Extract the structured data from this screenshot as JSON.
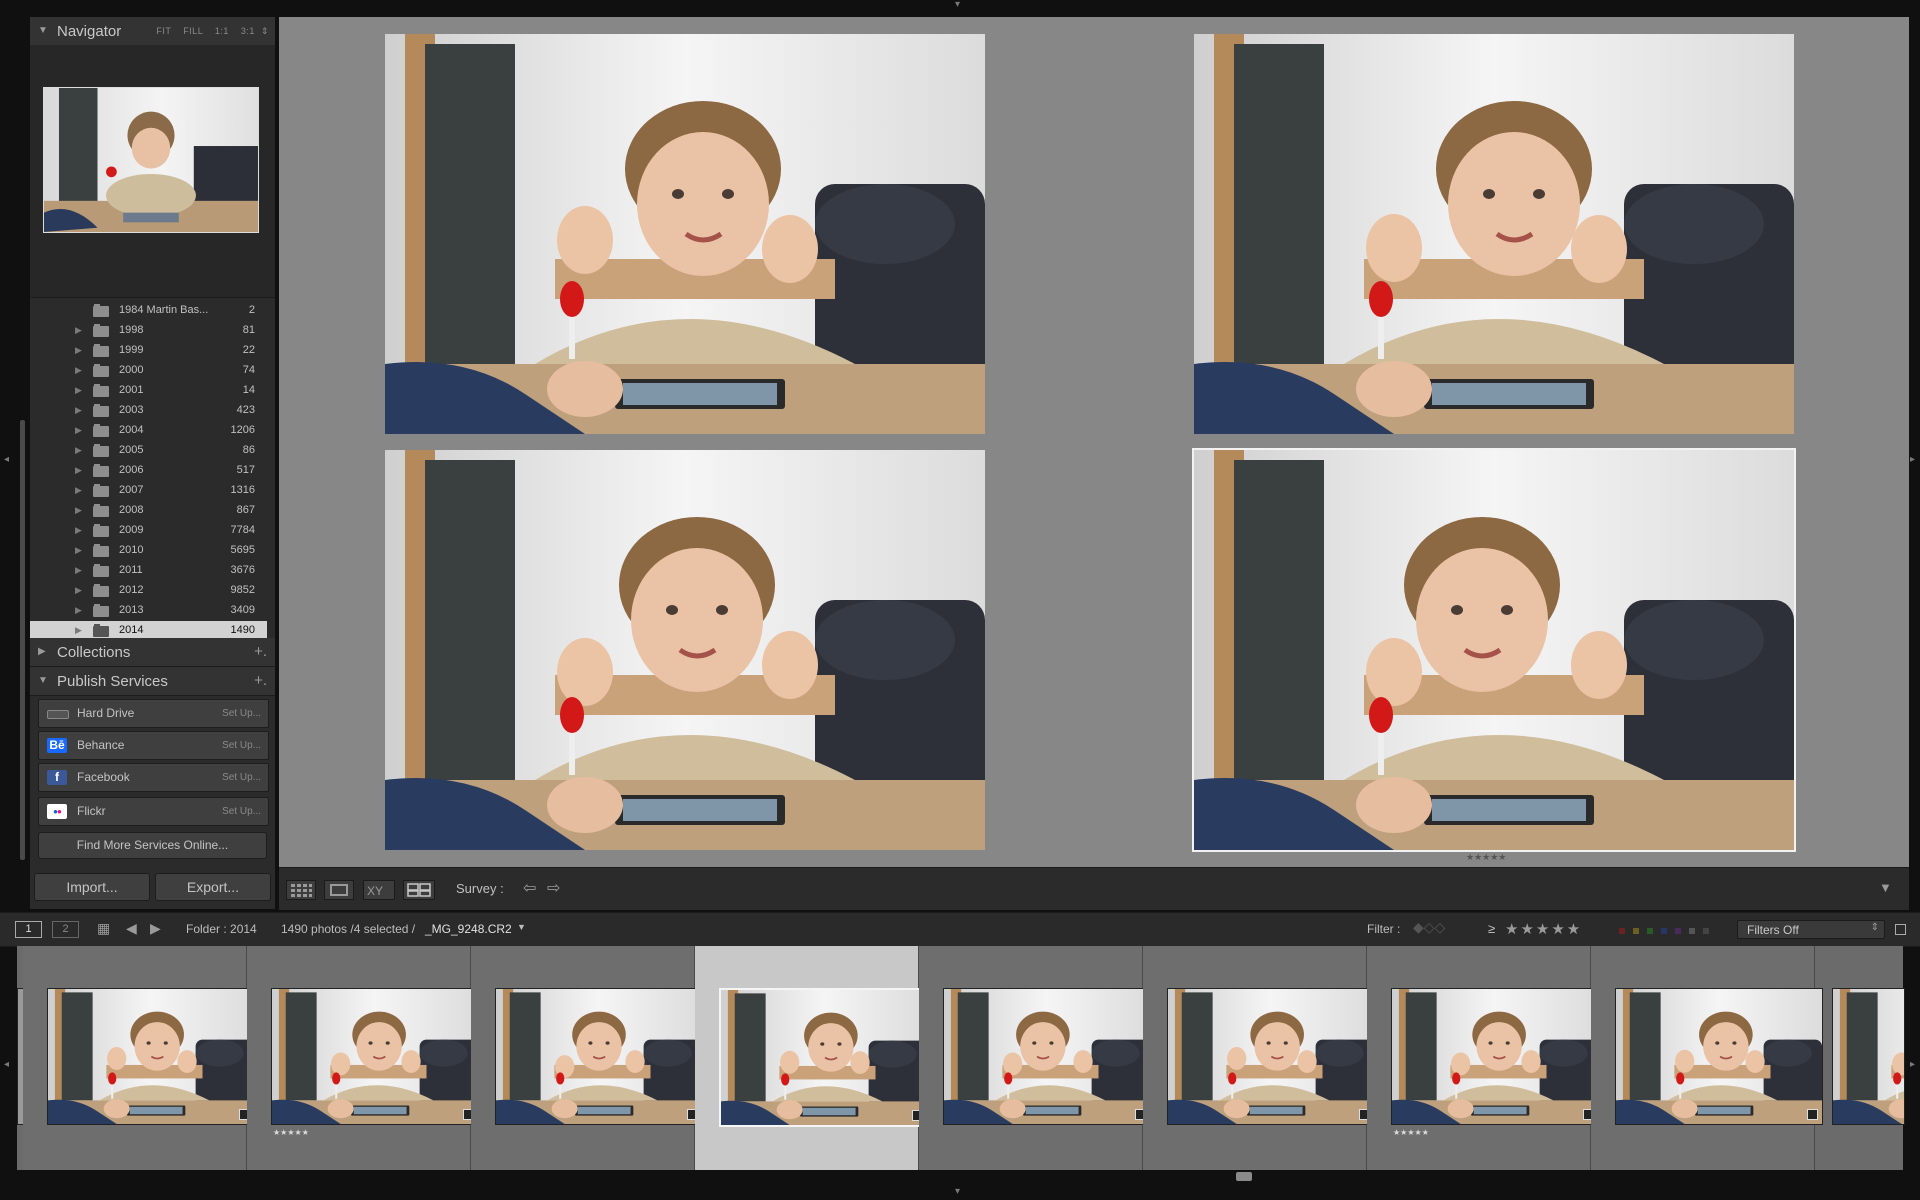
{
  "navigator": {
    "title": "Navigator",
    "modes": [
      "FIT",
      "FILL",
      "1:1",
      "3:1"
    ]
  },
  "folders": [
    {
      "name": "1984 Martin Bas...",
      "count": "2"
    },
    {
      "name": "1998",
      "count": "81"
    },
    {
      "name": "1999",
      "count": "22"
    },
    {
      "name": "2000",
      "count": "74"
    },
    {
      "name": "2001",
      "count": "14"
    },
    {
      "name": "2003",
      "count": "423"
    },
    {
      "name": "2004",
      "count": "1206"
    },
    {
      "name": "2005",
      "count": "86"
    },
    {
      "name": "2006",
      "count": "517"
    },
    {
      "name": "2007",
      "count": "1316"
    },
    {
      "name": "2008",
      "count": "867"
    },
    {
      "name": "2009",
      "count": "7784"
    },
    {
      "name": "2010",
      "count": "5695"
    },
    {
      "name": "2011",
      "count": "3676"
    },
    {
      "name": "2012",
      "count": "9852"
    },
    {
      "name": "2013",
      "count": "3409"
    },
    {
      "name": "2014",
      "count": "1490"
    }
  ],
  "collections": {
    "title": "Collections"
  },
  "publish": {
    "title": "Publish Services",
    "services": [
      {
        "name": "Hard Drive",
        "action": "Set Up...",
        "icon": "hard-drive-icon",
        "icon_text": "",
        "color": "#555555"
      },
      {
        "name": "Behance",
        "action": "Set Up...",
        "icon": "behance-icon",
        "icon_text": "Bē",
        "color": "#1769ff"
      },
      {
        "name": "Facebook",
        "action": "Set Up...",
        "icon": "facebook-icon",
        "icon_text": "f",
        "color": "#3b5998"
      },
      {
        "name": "Flickr",
        "action": "Set Up...",
        "icon": "flickr-icon",
        "icon_text": "●●",
        "color": "#ffffff"
      }
    ],
    "find_more": "Find More Services Online..."
  },
  "buttons": {
    "import": "Import...",
    "export": "Export..."
  },
  "toolbar": {
    "survey_label": "Survey :"
  },
  "filter_bar": {
    "page_1": "1",
    "page_2": "2",
    "folder": "Folder : 2014",
    "status": "1490 photos /4 selected /",
    "filename": "_MG_9248.CR2",
    "filter_label": "Filter :",
    "rating_op": "≥",
    "rating_stars": "★★★★★",
    "filter_value": "Filters Off"
  },
  "survey_rating": "★★★★★",
  "filmstrip_stars": "★★★★★",
  "colors": {
    "accent_selected": "#d2d2d2",
    "panel": "#2b2b2b",
    "center_bg": "#878787"
  }
}
